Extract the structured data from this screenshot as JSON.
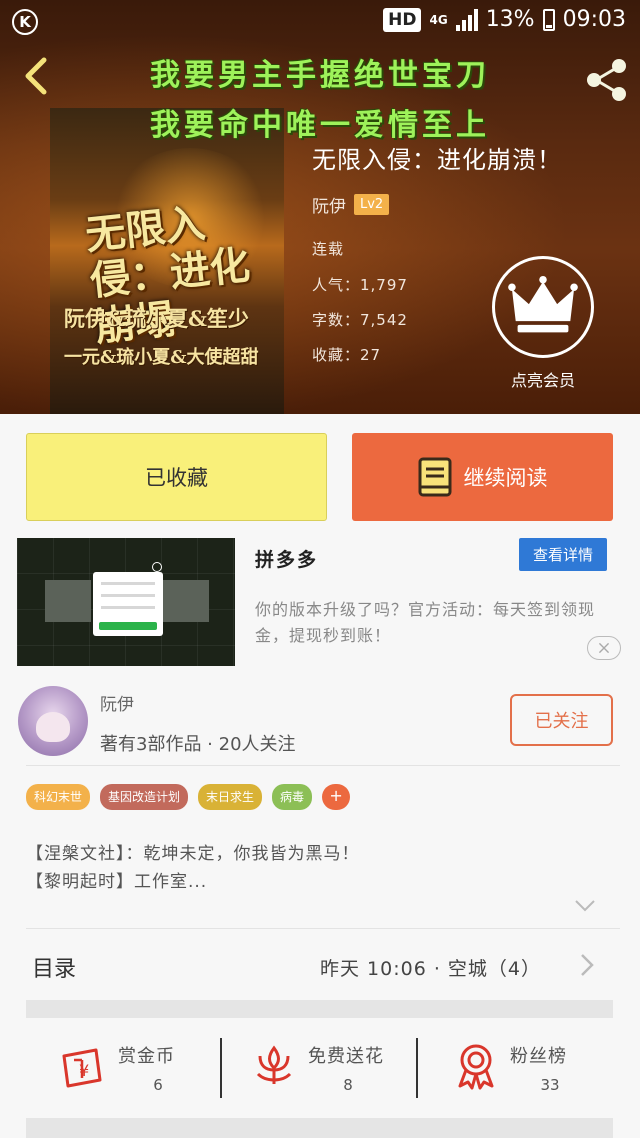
{
  "status_bar": {
    "hd": "HD",
    "network": "4G",
    "battery": "13%",
    "time": "09:03"
  },
  "promo": {
    "line1": "我要男主手握绝世宝刀",
    "line2": "我要命中唯一爱情至上"
  },
  "cover": {
    "title": "无限入侵：进化崩塌",
    "authors": "阮伊&琉小夏&笙少",
    "sub": "一元&琉小夏&大使超甜"
  },
  "book": {
    "title": "无限入侵：进化崩溃！",
    "author": "阮伊",
    "level": "Lv2",
    "status": "连载",
    "popularity": "人气：1,797",
    "word_count": "字数：7,542",
    "favorites": "收藏：27",
    "vip_label": "点亮会员"
  },
  "actions": {
    "collected": "已收藏",
    "continue_reading": "继续阅读"
  },
  "ad": {
    "brand": "拼多多",
    "detail_button": "查看详情",
    "text": "你的版本升级了吗？官方活动：每天签到领现金，提现秒到账！"
  },
  "author_card": {
    "name": "阮伊",
    "stats": "著有3部作品 · 20人关注",
    "follow_button": "已关注"
  },
  "tags": [
    {
      "label": "科幻末世",
      "color": "#f3b14a"
    },
    {
      "label": "基因改造计划",
      "color": "#c26a5c"
    },
    {
      "label": "末日求生",
      "color": "#d9b236"
    },
    {
      "label": "病毒",
      "color": "#8cbf56"
    }
  ],
  "tag_add": "+",
  "intro": {
    "line1": "【涅槃文社】：乾坤未定，你我皆为黑马！",
    "line2": "【黎明起时】工作室..."
  },
  "toc": {
    "label": "目录",
    "update": "昨天 10:06 · 空城（4）"
  },
  "bottom_stats": [
    {
      "label": "赏金币",
      "value": "6",
      "icon": "reward-coin-icon"
    },
    {
      "label": "免费送花",
      "value": "8",
      "icon": "flower-icon"
    },
    {
      "label": "粉丝榜",
      "value": "33",
      "icon": "fan-rank-icon"
    }
  ],
  "colors": {
    "accent": "#ec693f",
    "collected_bg": "#f9f07a",
    "promo_text": "#9ef25a",
    "detail_blue": "#2f79d6"
  }
}
